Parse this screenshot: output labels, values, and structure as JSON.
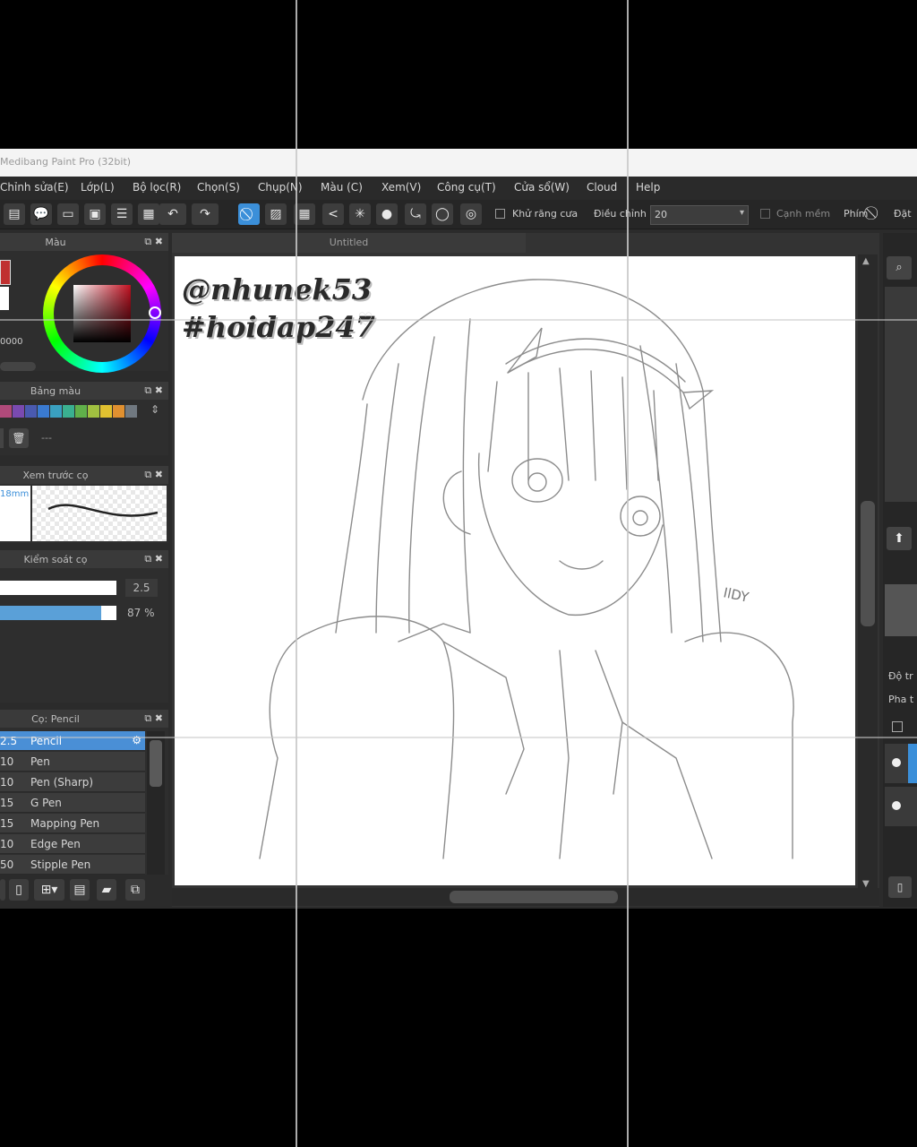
{
  "app": {
    "title": "Medibang Paint Pro (32bit)",
    "menu": [
      "Chỉnh sửa(E)",
      "Lớp(L)",
      "Bộ lọc(R)",
      "Chọn(S)",
      "Chụp(N)",
      "Màu (C)",
      "Xem(V)",
      "Công cụ(T)",
      "Cửa sổ(W)",
      "Cloud",
      "Help"
    ]
  },
  "toolbar": {
    "antialias_label": "Khử răng cưa",
    "correction_label": "Điều chỉnh",
    "correction_value": "20",
    "soft_edge_label": "Cạnh mềm",
    "key_label": "Phím",
    "set_label": "Đặt"
  },
  "panels": {
    "color_title": "Màu",
    "color_hex": "0000",
    "palette_title": "Bảng màu",
    "palette_ellipsis": "---",
    "brush_preview_title": "Xem trước cọ",
    "brush_preview_size": "18mm",
    "brush_control_title": "Kiểm soát cọ",
    "brush_size_value": "2.5",
    "brush_opacity_value": "87 %",
    "brush_list_title": "Cọ: Pencil"
  },
  "brushes": [
    {
      "size": "2.5",
      "name": "Pencil",
      "selected": true
    },
    {
      "size": "10",
      "name": "Pen"
    },
    {
      "size": "10",
      "name": "Pen (Sharp)"
    },
    {
      "size": "15",
      "name": "G Pen"
    },
    {
      "size": "15",
      "name": "Mapping Pen"
    },
    {
      "size": "10",
      "name": "Edge Pen"
    },
    {
      "size": "50",
      "name": "Stipple Pen"
    }
  ],
  "canvas": {
    "tab_title": "Untitled",
    "watermark_line1": "@nhunek53",
    "watermark_line2": "#hoidap247",
    "signature": "IlDY"
  },
  "right_panel": {
    "opacity_label": "Độ tr",
    "blend_label": "Pha t"
  },
  "colors": {
    "accent": "#3b8fd9",
    "panel_bg": "#2e2e2e",
    "menu_bg": "#2a2a2a",
    "paper": "#ffffff"
  },
  "palette_swatches": [
    "#b04a7a",
    "#7a4ab0",
    "#4a5ab0",
    "#3a7ad0",
    "#3aa0c0",
    "#3ab090",
    "#60b04a",
    "#a0c040",
    "#e0c030",
    "#e09030",
    "#707880"
  ]
}
